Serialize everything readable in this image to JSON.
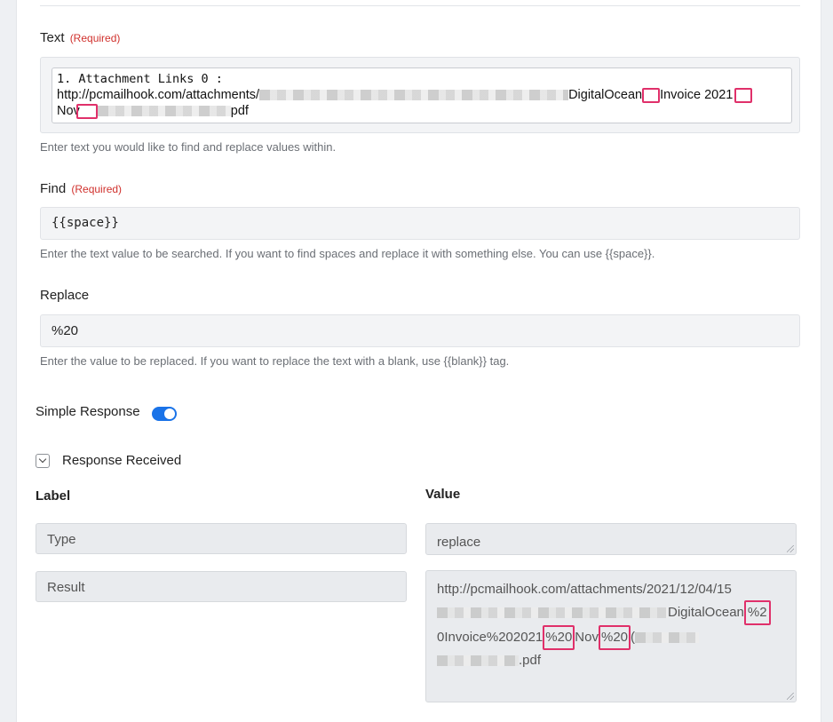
{
  "text_field": {
    "label": "Text",
    "required": "(Required)",
    "line1": "1. Attachment Links 0 :",
    "line2_prefix": "http://pcmailhook.com/attachments/",
    "line2_mid": "DigitalOcean",
    "line2_suffix": "Invoice 2021",
    "line3_prefix": "Nov",
    "line3_suffix": "pdf",
    "help": "Enter text you would like to find and replace values within."
  },
  "find_field": {
    "label": "Find",
    "required": "(Required)",
    "value": "{{space}}",
    "help": "Enter the text value to be searched. If you want to find spaces and replace it with something else. You can use {{space}}."
  },
  "replace_field": {
    "label": "Replace",
    "value": "%20",
    "help": "Enter the value to be replaced. If you want to replace the text with a blank, use {{blank}} tag."
  },
  "simple_response": {
    "label": "Simple Response",
    "enabled": true
  },
  "response": {
    "toggle_label": "Response Received",
    "label_header": "Label",
    "value_header": "Value",
    "rows": [
      {
        "label": "Type",
        "value": "replace"
      },
      {
        "label": "Result",
        "line1": "http://pcmailhook.com/attachments/2021/12/04/15",
        "line2_text": "DigitalOcean",
        "line2_mark": "%2",
        "line3_a": "0Invoice%202021",
        "line3_mark1": "%20",
        "line3_b": "Nov",
        "line3_mark2": "%20",
        "line3_c": "(",
        "line4": ".pdf"
      }
    ]
  },
  "colors": {
    "toggle": "#1a73e8",
    "required": "#d0312d",
    "highlight": "#e0306a"
  }
}
